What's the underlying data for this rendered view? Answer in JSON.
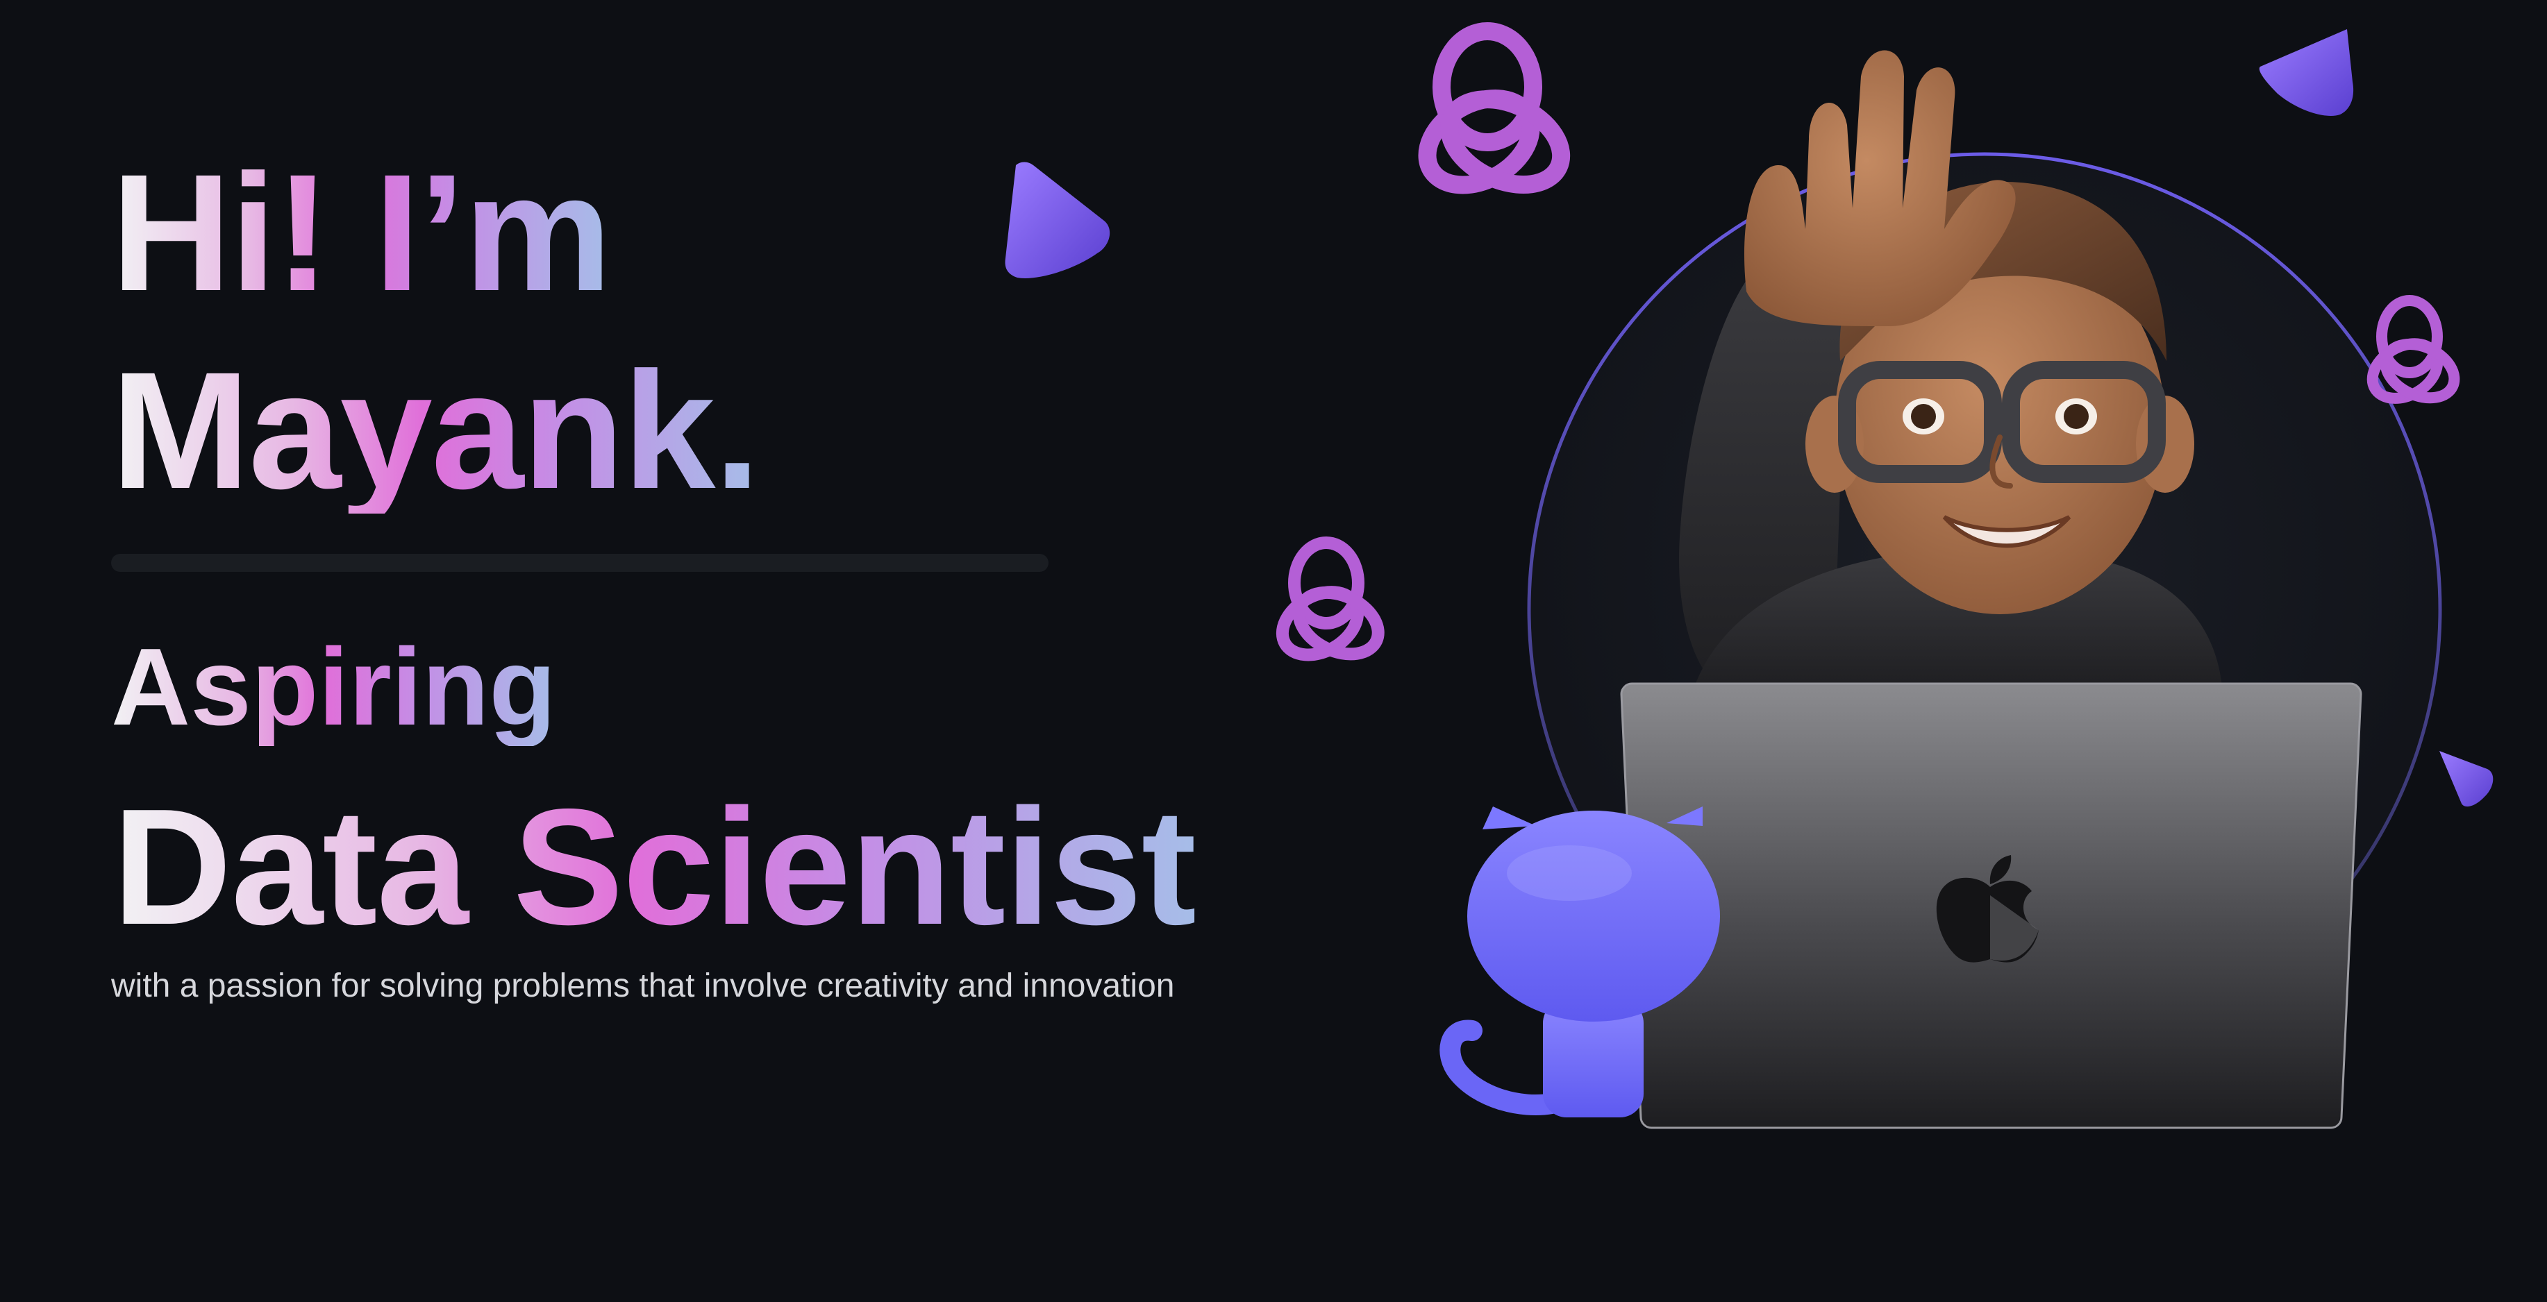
{
  "hero": {
    "greeting_hi": "Hi!",
    "greeting_im": "I’m",
    "name": "Mayank.",
    "prefix": "Aspiring",
    "role": "Data Scientist",
    "tagline": "with a passion for solving problems that involve creativity and innovation"
  },
  "illustration": {
    "icons": [
      "waving-avatar-icon",
      "laptop-icon",
      "apple-logo-icon",
      "octocat-icon",
      "torus-knot-icon",
      "cone-icon"
    ]
  },
  "colors": {
    "background": "#0d0f14",
    "accent_pink": "#e06fd9",
    "accent_purple": "#8a6cf0",
    "accent_blue": "#a6bde8"
  }
}
